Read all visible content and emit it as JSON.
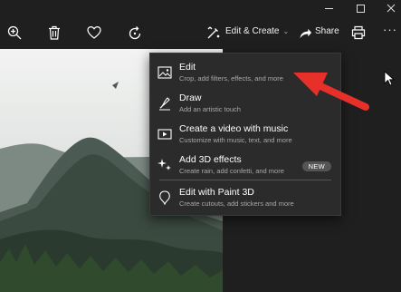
{
  "window": {
    "minimize": "minimize",
    "maximize": "maximize",
    "close": "close"
  },
  "toolbar": {
    "zoom_icon": "zoom-in-icon",
    "delete_icon": "trash-icon",
    "favorite_icon": "heart-icon",
    "rotate_icon": "rotate-icon",
    "edit_create_label": "Edit & Create",
    "share_label": "Share",
    "print_icon": "printer-icon",
    "more_label": "···"
  },
  "menu": {
    "items": [
      {
        "title": "Edit",
        "subtitle": "Crop, add filters, effects, and more",
        "icon": "photo-edit-icon"
      },
      {
        "title": "Draw",
        "subtitle": "Add an artistic touch",
        "icon": "pen-icon"
      },
      {
        "title": "Create a video with music",
        "subtitle": "Customize with music, text, and more",
        "icon": "video-icon"
      },
      {
        "title": "Add 3D effects",
        "subtitle": "Create rain, add confetti, and more",
        "icon": "sparkle-icon",
        "badge": "NEW"
      },
      {
        "title": "Edit with Paint 3D",
        "subtitle": "Create cutouts, add stickers and more",
        "icon": "paint3d-icon"
      }
    ]
  },
  "colors": {
    "background": "#1f1f1f",
    "menu": "#2b2b2b",
    "annotation_arrow": "#e8302a"
  }
}
